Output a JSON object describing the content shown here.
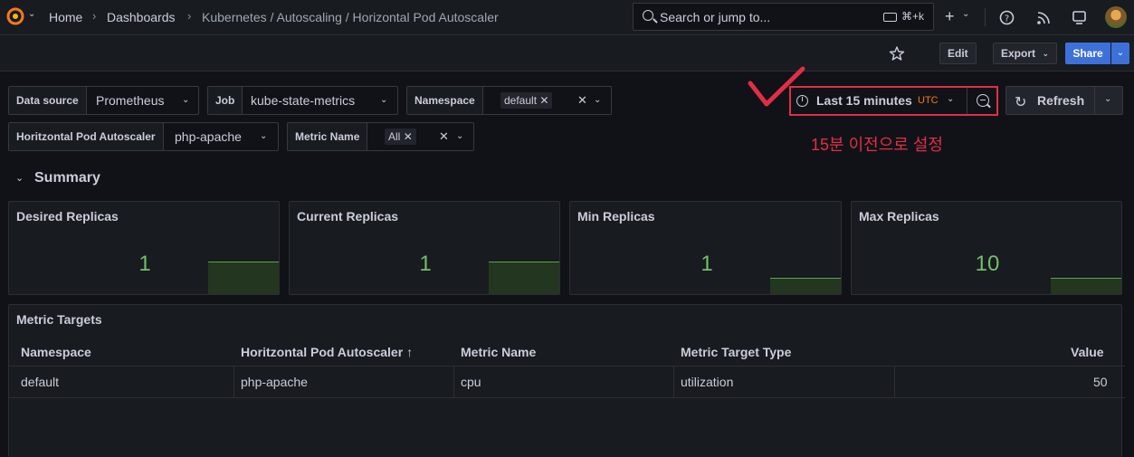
{
  "topbar": {
    "breadcrumbs": [
      "Home",
      "Dashboards",
      "Kubernetes / Autoscaling / Horizontal Pod Autoscaler"
    ],
    "search_placeholder": "Search or jump to...",
    "search_shortcut": "⌘+k",
    "new_label": "+"
  },
  "actions": {
    "edit_label": "Edit",
    "export_label": "Export",
    "share_label": "Share"
  },
  "variables": {
    "data_source": {
      "label": "Data source",
      "value": "Prometheus"
    },
    "job": {
      "label": "Job",
      "value": "kube-state-metrics"
    },
    "namespace": {
      "label": "Namespace",
      "value": "default"
    },
    "hpa": {
      "label": "Horitzontal Pod Autoscaler",
      "value": "php-apache"
    },
    "metric_name": {
      "label": "Metric Name",
      "value": "All"
    }
  },
  "time_picker": {
    "range": "Last 15 minutes",
    "timezone": "UTC",
    "refresh_label": "Refresh"
  },
  "annotation": {
    "text": "15분 이전으로 설정",
    "color": "#e02f44"
  },
  "summary_row": {
    "title": "Summary",
    "stats": [
      {
        "title": "Desired Replicas",
        "value": "1",
        "spark_level": 0.5
      },
      {
        "title": "Current Replicas",
        "value": "1",
        "spark_level": 0.5
      },
      {
        "title": "Min Replicas",
        "value": "1",
        "spark_level": 0.25
      },
      {
        "title": "Max Replicas",
        "value": "10",
        "spark_level": 0.25
      }
    ],
    "stat_color": "#73bf69"
  },
  "metric_targets": {
    "title": "Metric Targets",
    "columns": [
      "Namespace",
      "Horitzontal Pod Autoscaler",
      "Metric Name",
      "Metric Target Type",
      "Value"
    ],
    "sort_indicator": "↑",
    "rows": [
      [
        "default",
        "php-apache",
        "cpu",
        "utilization",
        "50"
      ]
    ]
  }
}
